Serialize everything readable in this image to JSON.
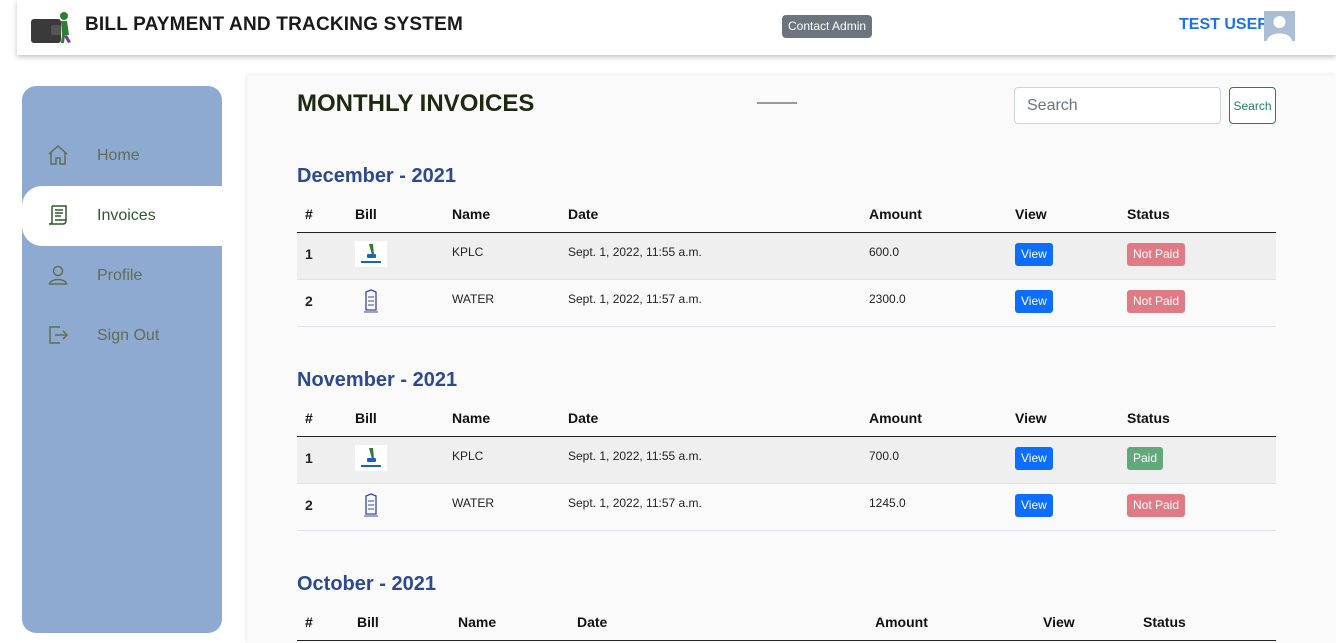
{
  "header": {
    "app_title": "BILL PAYMENT AND TRACKING SYSTEM",
    "contact_label": "Contact Admin",
    "user_name": "TEST USER"
  },
  "sidebar": {
    "items": [
      {
        "label": "Home",
        "icon": "home-icon",
        "active": false
      },
      {
        "label": "Invoices",
        "icon": "invoice-icon",
        "active": true
      },
      {
        "label": "Profile",
        "icon": "user-icon",
        "active": false
      },
      {
        "label": "Sign Out",
        "icon": "sign-out-icon",
        "active": false
      }
    ]
  },
  "main": {
    "title": "MONTHLY INVOICES",
    "search_placeholder": "Search",
    "search_button": "Search",
    "columns": [
      "#",
      "Bill",
      "Name",
      "Date",
      "Amount",
      "View",
      "Status"
    ],
    "months": [
      {
        "heading": "December - 2021",
        "rows": [
          {
            "num": "1",
            "bill_icon": "kplc-logo-icon",
            "name": "KPLC",
            "date": "Sept. 1, 2022, 11:55 a.m.",
            "amount": "600.0",
            "view": "View",
            "status": "Not Paid"
          },
          {
            "num": "2",
            "bill_icon": "water-logo-icon",
            "name": "WATER",
            "date": "Sept. 1, 2022, 11:57 a.m.",
            "amount": "2300.0",
            "view": "View",
            "status": "Not Paid"
          }
        ]
      },
      {
        "heading": "November - 2021",
        "rows": [
          {
            "num": "1",
            "bill_icon": "kplc-logo-icon",
            "name": "KPLC",
            "date": "Sept. 1, 2022, 11:55 a.m.",
            "amount": "700.0",
            "view": "View",
            "status": "Paid"
          },
          {
            "num": "2",
            "bill_icon": "water-logo-icon",
            "name": "WATER",
            "date": "Sept. 1, 2022, 11:57 a.m.",
            "amount": "1245.0",
            "view": "View",
            "status": "Not Paid"
          }
        ]
      },
      {
        "heading": "October - 2021",
        "rows": []
      }
    ]
  },
  "colors": {
    "sidebar_bg": "#8eaad0",
    "heading_blue": "#2c4a8f",
    "view_button": "#0d6efd",
    "not_paid": "#e07b85",
    "paid": "#62a87b"
  }
}
